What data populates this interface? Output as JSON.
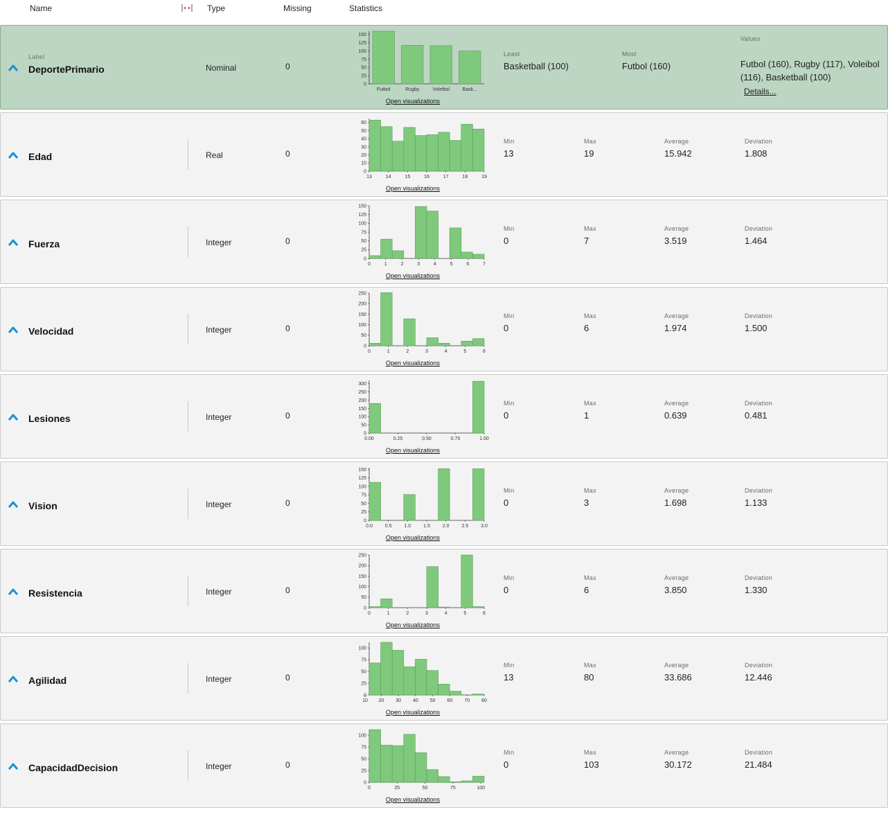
{
  "columns": {
    "name": "Name",
    "type": "Type",
    "missing": "Missing",
    "statistics": "Statistics"
  },
  "colors": {
    "bar": "#7fc97c",
    "bar_stroke": "#5a9e58",
    "selected_row": "#bcd6c3",
    "row": "#f3f3f3",
    "chevron": "#1f8fd1"
  },
  "open_vis": "Open visualizations",
  "stat_labels": {
    "least": "Least",
    "most": "Most",
    "values": "Values",
    "min": "Min",
    "max": "Max",
    "average": "Average",
    "deviation": "Deviation"
  },
  "label_tag": "Label",
  "details_link": "Details...",
  "attributes": [
    {
      "name": "DeportePrimario",
      "type": "Nominal",
      "missing": "0",
      "is_label": true,
      "least": "Basketball (100)",
      "most": "Futbol (160)",
      "values": "Futbol (160), Rugby (117), Voleibol (116), Basketball (100)"
    },
    {
      "name": "Edad",
      "type": "Real",
      "missing": "0",
      "min": "13",
      "max": "19",
      "average": "15.942",
      "deviation": "1.808"
    },
    {
      "name": "Fuerza",
      "type": "Integer",
      "missing": "0",
      "min": "0",
      "max": "7",
      "average": "3.519",
      "deviation": "1.464"
    },
    {
      "name": "Velocidad",
      "type": "Integer",
      "missing": "0",
      "min": "0",
      "max": "6",
      "average": "1.974",
      "deviation": "1.500"
    },
    {
      "name": "Lesiones",
      "type": "Integer",
      "missing": "0",
      "min": "0",
      "max": "1",
      "average": "0.639",
      "deviation": "0.481"
    },
    {
      "name": "Vision",
      "type": "Integer",
      "missing": "0",
      "min": "0",
      "max": "3",
      "average": "1.698",
      "deviation": "1.133"
    },
    {
      "name": "Resistencia",
      "type": "Integer",
      "missing": "0",
      "min": "0",
      "max": "6",
      "average": "3.850",
      "deviation": "1.330"
    },
    {
      "name": "Agilidad",
      "type": "Integer",
      "missing": "0",
      "min": "13",
      "max": "80",
      "average": "33.686",
      "deviation": "12.446"
    },
    {
      "name": "CapacidadDecision",
      "type": "Integer",
      "missing": "0",
      "min": "0",
      "max": "103",
      "average": "30.172",
      "deviation": "21.484"
    }
  ],
  "chart_data": [
    {
      "type": "bar",
      "attribute": "DeportePrimario",
      "categories": [
        "Futbol",
        "Rugby",
        "Voleibol",
        "Bask..."
      ],
      "values": [
        160,
        117,
        116,
        100
      ],
      "ylim": [
        0,
        160
      ],
      "yticks": [
        "0",
        "25",
        "50",
        "75",
        "100",
        "125",
        "150"
      ]
    },
    {
      "type": "bar",
      "attribute": "Edad",
      "x": [
        13,
        19
      ],
      "values": [
        63,
        55,
        37,
        54,
        44,
        45,
        48,
        38,
        58,
        52
      ],
      "ylim": [
        0,
        65
      ],
      "yticks": [
        "0",
        "10",
        "20",
        "30",
        "40",
        "50",
        "60"
      ],
      "xticks": [
        "13",
        "14",
        "15",
        "16",
        "17",
        "18",
        "19"
      ]
    },
    {
      "type": "bar",
      "attribute": "Fuerza",
      "x": [
        0,
        7
      ],
      "values": [
        8,
        55,
        22,
        0,
        148,
        135,
        0,
        87,
        18,
        12
      ],
      "ylim": [
        0,
        150
      ],
      "yticks": [
        "0",
        "25",
        "50",
        "75",
        "100",
        "125",
        "150"
      ],
      "xticks": [
        "0",
        "1",
        "2",
        "3",
        "4",
        "5",
        "6",
        "7"
      ]
    },
    {
      "type": "bar",
      "attribute": "Velocidad",
      "x": [
        0,
        6
      ],
      "values": [
        12,
        252,
        0,
        128,
        0,
        38,
        12,
        0,
        22,
        34
      ],
      "ylim": [
        0,
        250
      ],
      "yticks": [
        "0",
        "50",
        "100",
        "150",
        "200",
        "250"
      ],
      "xticks": [
        "0",
        "1",
        "2",
        "3",
        "4",
        "5",
        "6"
      ]
    },
    {
      "type": "bar",
      "attribute": "Lesiones",
      "x": [
        0,
        1
      ],
      "values": [
        180,
        0,
        0,
        0,
        0,
        0,
        0,
        0,
        0,
        315
      ],
      "ylim": [
        0,
        320
      ],
      "yticks": [
        "0",
        "50",
        "100",
        "150",
        "200",
        "250",
        "300"
      ],
      "xticks": [
        "0.00",
        "0.25",
        "0.50",
        "0.75",
        "1.00"
      ]
    },
    {
      "type": "bar",
      "attribute": "Vision",
      "x": [
        0,
        3
      ],
      "values": [
        112,
        0,
        0,
        76,
        0,
        0,
        152,
        0,
        0,
        152
      ],
      "ylim": [
        0,
        155
      ],
      "yticks": [
        "0",
        "25",
        "50",
        "75",
        "100",
        "125",
        "150"
      ],
      "xticks": [
        "0.0",
        "0.5",
        "1.0",
        "1.5",
        "2.0",
        "2.5",
        "3.0"
      ]
    },
    {
      "type": "bar",
      "attribute": "Resistencia",
      "x": [
        0,
        6
      ],
      "values": [
        5,
        42,
        0,
        0,
        0,
        195,
        3,
        0,
        250,
        5
      ],
      "ylim": [
        0,
        250
      ],
      "yticks": [
        "0",
        "50",
        "100",
        "150",
        "200",
        "250"
      ],
      "xticks": [
        "0",
        "1",
        "2",
        "3",
        "4",
        "5",
        "6"
      ]
    },
    {
      "type": "bar",
      "attribute": "Agilidad",
      "x": [
        13,
        80
      ],
      "values": [
        68,
        112,
        95,
        60,
        76,
        52,
        23,
        8,
        0,
        2
      ],
      "ylim": [
        0,
        112
      ],
      "yticks": [
        "0",
        "25",
        "50",
        "75",
        "100"
      ],
      "xticks": [
        "10",
        "20",
        "30",
        "40",
        "50",
        "60",
        "70",
        "80"
      ]
    },
    {
      "type": "bar",
      "attribute": "CapacidadDecision",
      "x": [
        0,
        103
      ],
      "values": [
        112,
        79,
        78,
        102,
        63,
        27,
        12,
        1,
        3,
        13
      ],
      "ylim": [
        0,
        112
      ],
      "yticks": [
        "0",
        "25",
        "50",
        "75",
        "100"
      ],
      "xticks": [
        "0",
        "25",
        "50",
        "75",
        "100"
      ]
    }
  ]
}
